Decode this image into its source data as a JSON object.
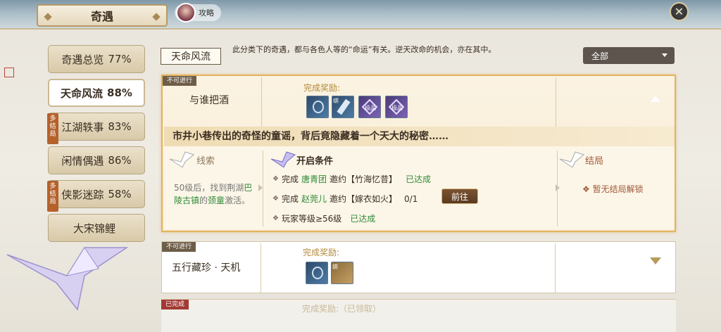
{
  "header": {
    "title": "奇遇",
    "guide_label": "攻略",
    "close_icon": "close-icon"
  },
  "sidebar": {
    "items": [
      {
        "label": "奇遇总览",
        "pct": "77%",
        "badge": ""
      },
      {
        "label": "天命风流",
        "pct": "88%",
        "badge": ""
      },
      {
        "label": "江湖轶事",
        "pct": "83%",
        "badge": "多结局"
      },
      {
        "label": "闲情偶遇",
        "pct": "86%",
        "badge": ""
      },
      {
        "label": "侠影迷踪",
        "pct": "58%",
        "badge": "多结局"
      },
      {
        "label": "大宋锦鲤",
        "pct": "",
        "badge": ""
      }
    ]
  },
  "category": {
    "title": "天命风流",
    "description": "此分类下的奇遇，都与各色人等的“命运”有关。逆天改命的机会，亦在其中。"
  },
  "filter": {
    "selected": "全部"
  },
  "cards": [
    {
      "status": "不可进行",
      "title": "与谁把酒",
      "reward_label": "完成奖励:",
      "story": "市井小巷传出的奇怪的童谣，背后竟隐藏着一个天大的秘密……",
      "clue_title": "线索",
      "clue_a": "50级后，找到荆湖",
      "clue_b": "巴陵古镇",
      "clue_c": "的",
      "clue_d": "颈童",
      "clue_e": "激活。",
      "cond_title": "开启条件",
      "cond1_a": "完成",
      "cond1_b": "唐青团",
      "cond1_c": "邀约【竹海忆昔】",
      "cond1_status": "已达成",
      "cond2_a": "完成",
      "cond2_b": "赵莞儿",
      "cond2_c": "邀约【嫁衣如火】",
      "cond2_progress": "0/1",
      "cond2_button": "前往",
      "cond3_a": "玩家等级≥56级",
      "cond3_status": "已达成",
      "ending_title": "结局",
      "ending_text": "暂无结局解锁",
      "icon_labels": [
        "绑",
        "极品",
        "极品"
      ]
    },
    {
      "status": "不可进行",
      "title": "五行藏珍 · 天机",
      "reward_label": "完成奖励:",
      "icon_labels": [
        "绑"
      ]
    },
    {
      "status": "已完成",
      "reward_label": "完成奖励:（已领取）"
    }
  ],
  "colors": {
    "accent": "#e2b25e",
    "done_green": "#2e8a36",
    "tag_red": "#a33a35"
  }
}
